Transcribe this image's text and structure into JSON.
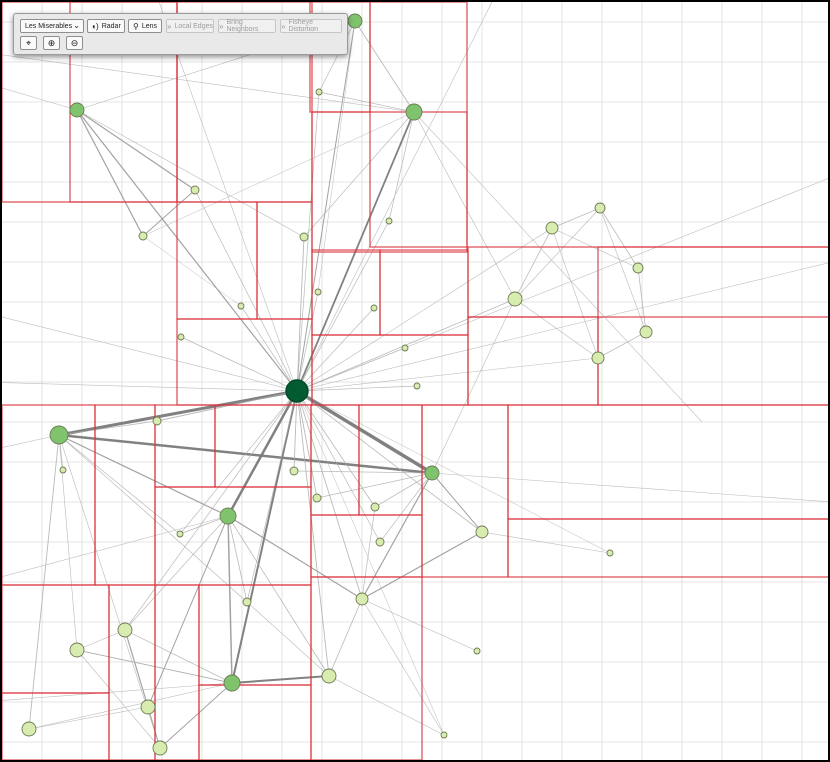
{
  "toolbar": {
    "dataset": {
      "selected": "Les Miserables",
      "icon": "chevron-down-icon"
    },
    "buttons": [
      {
        "label": "Radar",
        "icon": "radar-icon",
        "enabled": true
      },
      {
        "label": "Lens",
        "icon": "search-icon",
        "enabled": true
      },
      {
        "label": "Local Edges",
        "icon": "double-chevron-icon",
        "enabled": false
      },
      {
        "label": "Bring Neighbors",
        "icon": "double-chevron-icon",
        "enabled": false
      },
      {
        "label": "Fisheye Distortion",
        "icon": "double-chevron-icon",
        "enabled": false
      }
    ],
    "icon_buttons": [
      {
        "icon": "crosshair-icon",
        "glyph": "⌖"
      },
      {
        "icon": "zoom-in-icon",
        "glyph": "⊕"
      },
      {
        "icon": "zoom-out-icon",
        "glyph": "⊖"
      }
    ]
  },
  "colors": {
    "grid": "#dcdcdc",
    "partition": "#d9343d",
    "edge": "#8c8c8c",
    "node_light": "#d9ecb0",
    "node_mid": "#7fc46d",
    "node_focus": "#035b32",
    "node_stroke": "#6d7a55"
  }
}
